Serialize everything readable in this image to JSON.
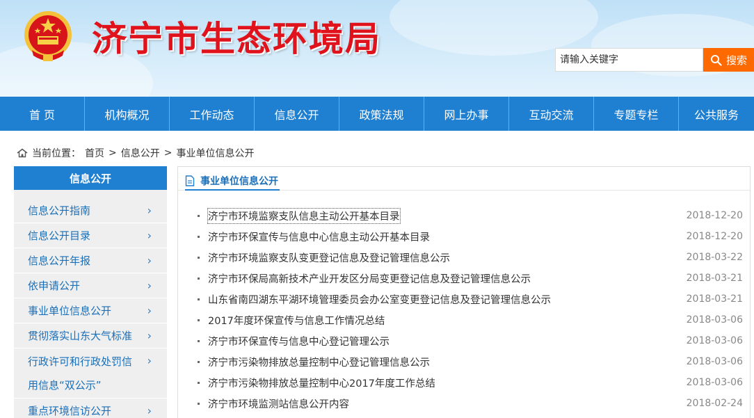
{
  "header": {
    "site_title": "济宁市生态环境局"
  },
  "search": {
    "placeholder": "请输入关键字",
    "button_label": "搜索"
  },
  "nav": [
    "首 页",
    "机构概况",
    "工作动态",
    "信息公开",
    "政策法规",
    "网上办事",
    "互动交流",
    "专题专栏",
    "公共服务"
  ],
  "breadcrumb": {
    "prefix": "当前位置：",
    "items": [
      "首页",
      "信息公开",
      "事业单位信息公开"
    ],
    "separator": ">"
  },
  "sidebar": {
    "title": "信息公开",
    "items": [
      "信息公开指南",
      "信息公开目录",
      "信息公开年报",
      "依申请公开",
      "事业单位信息公开",
      "贯彻落实山东大气标准",
      "行政许可和行政处罚信用信息“双公示”",
      "重点环境信访公开"
    ]
  },
  "content": {
    "title": "事业单位信息公开",
    "articles": [
      {
        "title": "济宁市环境监察支队信息主动公开基本目录",
        "date": "2018-12-20"
      },
      {
        "title": "济宁市环保宣传与信息中心信息主动公开基本目录",
        "date": "2018-12-20"
      },
      {
        "title": "济宁市环境监察支队变更登记信息及登记管理信息公示",
        "date": "2018-03-22"
      },
      {
        "title": "济宁市环保局高新技术产业开发区分局变更登记信息及登记管理信息公示",
        "date": "2018-03-21"
      },
      {
        "title": "山东省南四湖东平湖环境管理委员会办公室变更登记信息及登记管理信息公示",
        "date": "2018-03-21"
      },
      {
        "title": "2017年度环保宣传与信息工作情况总结",
        "date": "2018-03-06"
      },
      {
        "title": "济宁市环保宣传与信息中心登记管理公示",
        "date": "2018-03-06"
      },
      {
        "title": "济宁市污染物排放总量控制中心登记管理信息公示",
        "date": "2018-03-06"
      },
      {
        "title": "济宁市污染物排放总量控制中心2017年度工作总结",
        "date": "2018-03-06"
      },
      {
        "title": "济宁市环境监测站信息公开内容",
        "date": "2018-02-24"
      }
    ]
  },
  "colors": {
    "brand_blue": "#1f7fd0",
    "search_orange": "#ff6a00",
    "title_red": "#e0121b"
  },
  "icons": [
    "national-emblem-icon",
    "search-icon",
    "home-icon",
    "document-icon",
    "chevron-right-icon"
  ]
}
